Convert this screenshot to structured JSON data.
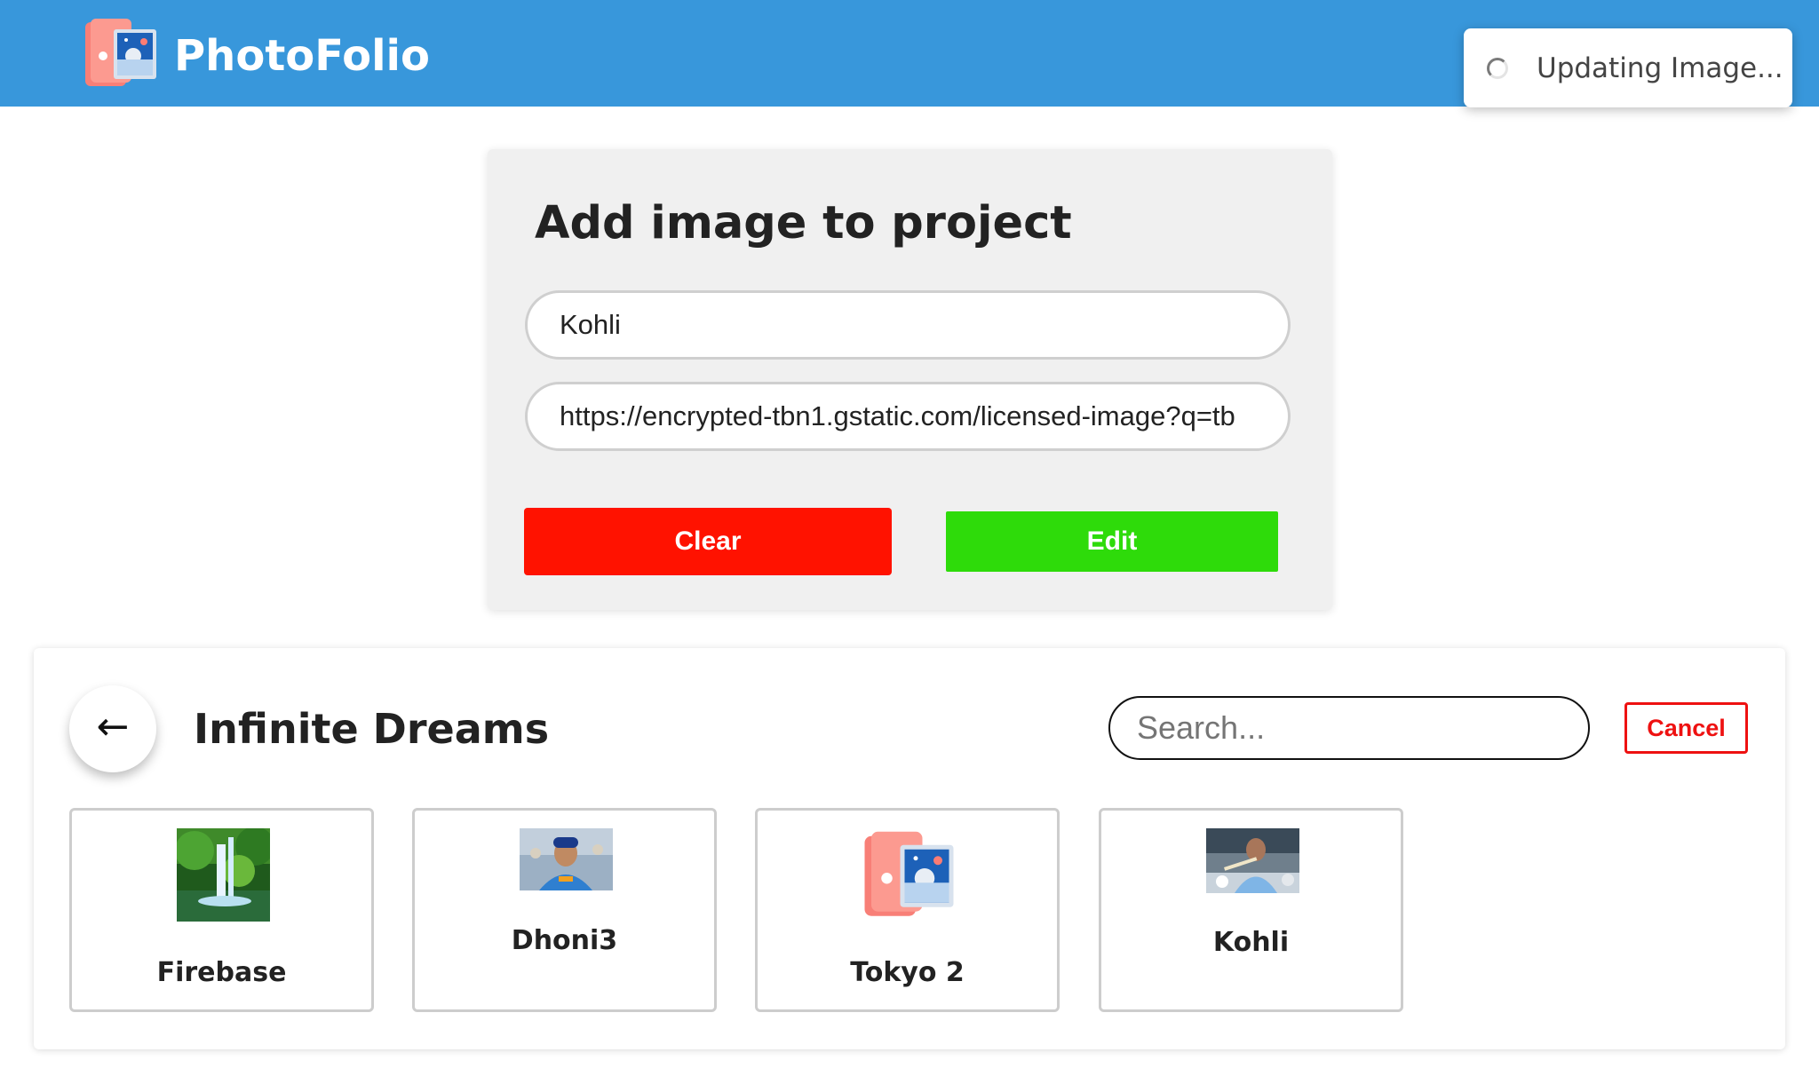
{
  "header": {
    "brand": "PhotoFolio",
    "logo_icon": "photo-album-icon",
    "background_color": "#3897db"
  },
  "toast": {
    "text": "Updating Image...",
    "icon": "spinner-icon"
  },
  "form": {
    "title": "Add image to project",
    "title_input_value": "Kohli",
    "url_input_value": "https://encrypted-tbn1.gstatic.com/licensed-image?q=tb",
    "clear_label": "Clear",
    "edit_label": "Edit",
    "clear_color": "#ff1200",
    "edit_color": "#2edb0a"
  },
  "project": {
    "back_icon": "←",
    "title": "Infinite Dreams",
    "search_placeholder": "Search...",
    "cancel_label": "Cancel",
    "images": [
      {
        "label": "Firebase",
        "thumb": "waterfall-photo"
      },
      {
        "label": "Dhoni3",
        "thumb": "cricketer-photo"
      },
      {
        "label": "Tokyo 2",
        "thumb": "photo-album-icon"
      },
      {
        "label": "Kohli",
        "thumb": "cricketer-photo"
      }
    ]
  }
}
